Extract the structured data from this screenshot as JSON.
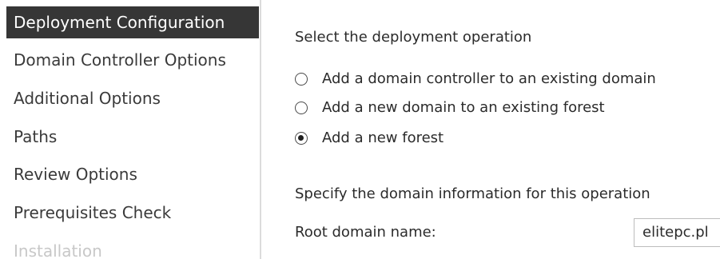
{
  "sidebar": {
    "items": [
      {
        "label": "Deployment Configuration",
        "state": "active"
      },
      {
        "label": "Domain Controller Options",
        "state": "normal"
      },
      {
        "label": "Additional Options",
        "state": "normal"
      },
      {
        "label": "Paths",
        "state": "normal"
      },
      {
        "label": "Review Options",
        "state": "normal"
      },
      {
        "label": "Prerequisites Check",
        "state": "normal"
      },
      {
        "label": "Installation",
        "state": "disabled"
      }
    ]
  },
  "main": {
    "operation_heading": "Select the deployment operation",
    "operations": [
      {
        "label": "Add a domain controller to an existing domain",
        "selected": false
      },
      {
        "label": "Add a new domain to an existing forest",
        "selected": false
      },
      {
        "label": "Add a new forest",
        "selected": true
      }
    ],
    "domain_heading": "Specify the domain information for this operation",
    "root_domain": {
      "label": "Root domain name:",
      "value": "elitepc.pl"
    }
  },
  "colors": {
    "active_bg": "#363636",
    "active_fg": "#ffffff",
    "disabled_fg": "#c8c8c8"
  }
}
